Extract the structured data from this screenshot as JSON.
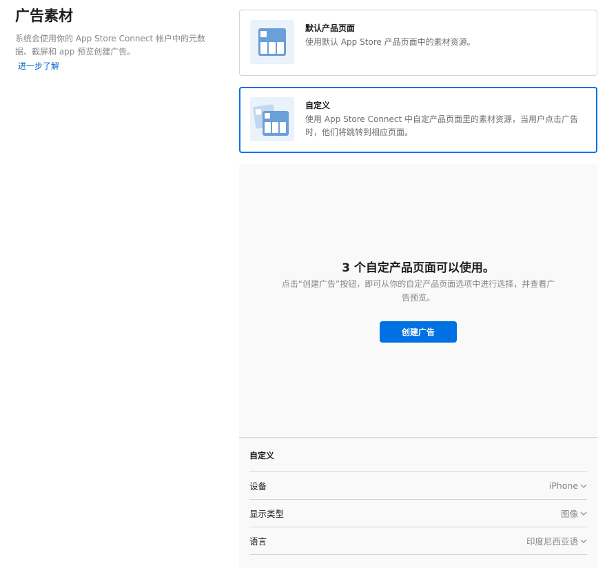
{
  "sidebar": {
    "title": "广告素材",
    "description": "系统会使用你的 App Store Connect 帐户中的元数据、截屏和 app 预览创建广告。",
    "learn_more": "进一步了解"
  },
  "options": {
    "default": {
      "title": "默认产品页面",
      "description": "使用默认 App Store 产品页面中的素材资源。",
      "icon": "default-product-page-icon",
      "selected": false
    },
    "custom": {
      "title": "自定义",
      "description": "使用 App Store Connect 中自定产品页面里的素材资源，当用户点击广告时，他们将跳转到相应页面。",
      "icon": "custom-product-pages-icon",
      "selected": true
    }
  },
  "empty_state": {
    "title": "3 个自定产品页面可以使用。",
    "text": "点击“创建广告”按钮，即可从你的自定产品页面选项中进行选择，并查看广告预览。",
    "button_label": "创建广告"
  },
  "settings": {
    "title": "自定义",
    "rows": [
      {
        "label": "设备",
        "value": "iPhone"
      },
      {
        "label": "显示类型",
        "value": "图像"
      },
      {
        "label": "语言",
        "value": "印度尼西亚语"
      }
    ]
  },
  "colors": {
    "accent": "#0071e3",
    "link": "#0066cc",
    "icon_fill": "#6a9fd8",
    "icon_bg": "#eaf2fb"
  }
}
